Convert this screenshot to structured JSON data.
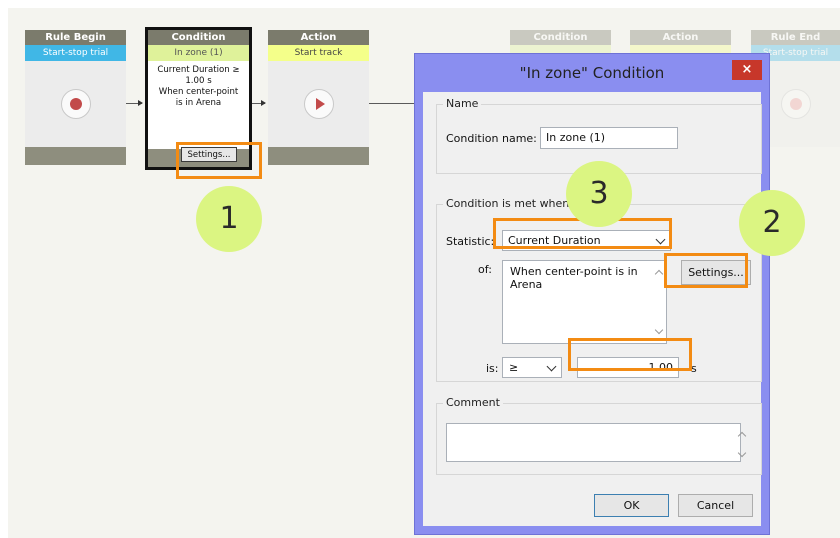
{
  "flow": {
    "blocks": [
      {
        "header": "Rule Begin",
        "subtitle": "Start-stop trial"
      },
      {
        "header": "Condition",
        "subtitle": "In zone (1)",
        "details": [
          "Current Duration ≥",
          "1.00 s",
          "When center-point",
          "is in Arena"
        ],
        "settings_label": "Settings..."
      },
      {
        "header": "Action",
        "subtitle": "Start track"
      },
      {
        "header": "Condition"
      },
      {
        "header": "Action"
      },
      {
        "header": "Rule End",
        "subtitle": "Start-stop trial"
      }
    ]
  },
  "callouts": [
    "1",
    "2",
    "3"
  ],
  "dialog": {
    "title": "\"In zone\" Condition",
    "close_label": "×",
    "name_group": {
      "legend": "Name",
      "field_label": "Condition name:",
      "field_value": "In zone (1)"
    },
    "condition_group": {
      "legend": "Condition is met when:",
      "statistic_label": "Statistic:",
      "statistic_value": "Current Duration",
      "of_label": "of:",
      "of_text": "When center-point is in Arena",
      "settings_label": "Settings...",
      "is_label": "is:",
      "operator_value": "≥",
      "threshold_value": "1.00",
      "unit": "s"
    },
    "comment_group": {
      "legend": "Comment",
      "value": ""
    },
    "ok_label": "OK",
    "cancel_label": "Cancel"
  },
  "colors": {
    "highlight": "#f38b13",
    "callout": "#dbf582",
    "dialog_frame": "#8a8ef0"
  }
}
